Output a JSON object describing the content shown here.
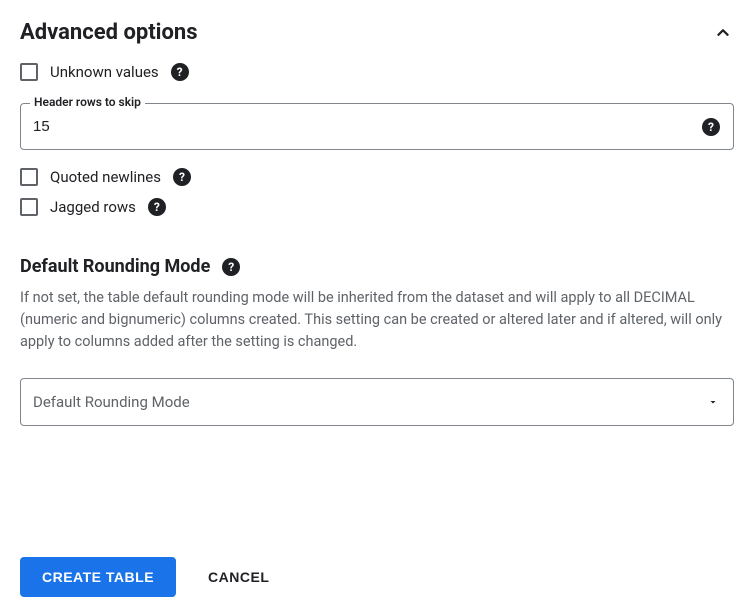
{
  "section": {
    "title": "Advanced options"
  },
  "checkboxes": {
    "unknown_values": {
      "label": "Unknown values"
    },
    "quoted_newlines": {
      "label": "Quoted newlines"
    },
    "jagged_rows": {
      "label": "Jagged rows"
    }
  },
  "header_rows_field": {
    "label": "Header rows to skip",
    "value": "15"
  },
  "rounding": {
    "title": "Default Rounding Mode",
    "description": "If not set, the table default rounding mode will be inherited from the dataset and will apply to all DECIMAL (numeric and bignumeric) columns created. This setting can be created or altered later and if altered, will only apply to columns added after the setting is changed.",
    "select_placeholder": "Default Rounding Mode"
  },
  "footer": {
    "create_label": "CREATE TABLE",
    "cancel_label": "CANCEL"
  }
}
